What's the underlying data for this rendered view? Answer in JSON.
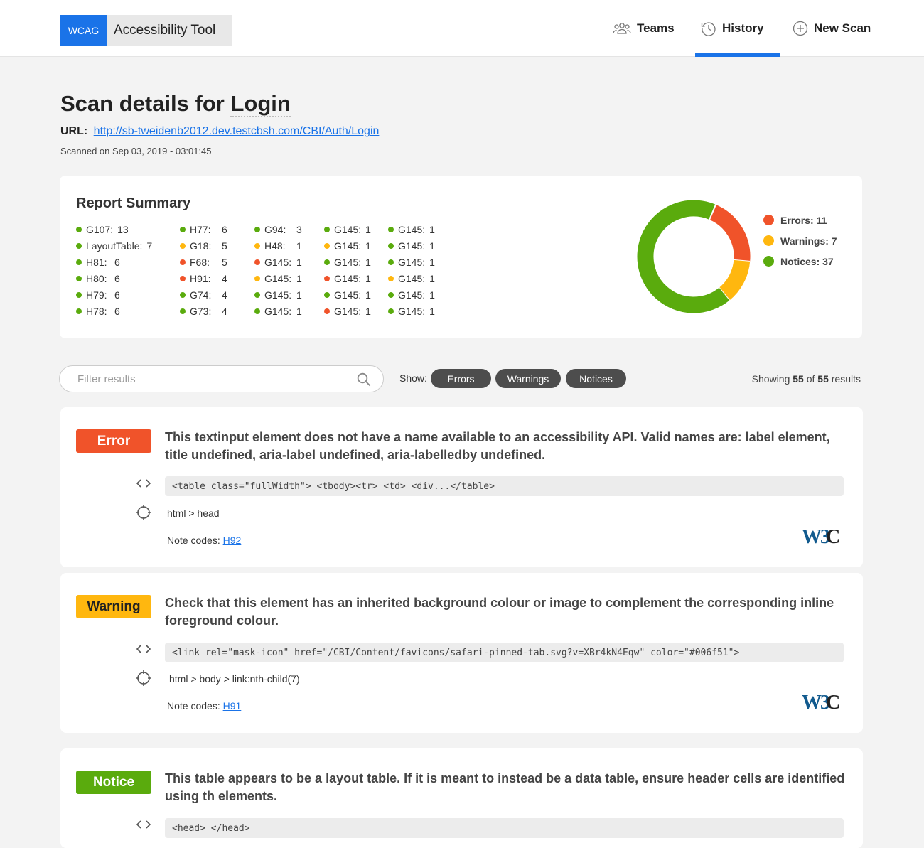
{
  "header": {
    "brand_badge": "WCAG",
    "brand_name": "Accessibility Tool",
    "nav": [
      {
        "label": "Teams",
        "icon": "users-icon"
      },
      {
        "label": "History",
        "icon": "clock-icon",
        "active": true
      },
      {
        "label": "New Scan",
        "icon": "plus-circle-icon"
      }
    ]
  },
  "page": {
    "title_prefix": "Scan details for",
    "title_page": "Login",
    "url_label": "URL:",
    "url": "http://sb-tweidenb2012.dev.testcbsh.com/CBI/Auth/Login",
    "scanned": "Scanned on Sep 03, 2019 - 03:01:45"
  },
  "summary": {
    "title": "Report Summary",
    "colors": {
      "error": "#f0532a",
      "warning": "#ffb70f",
      "notice": "#5aab0d"
    },
    "columns": [
      [
        {
          "code": "G107:",
          "value": "13",
          "type": "notice"
        },
        {
          "code": "LayoutTable:",
          "value": "7",
          "type": "notice"
        },
        {
          "code": "H81:",
          "value": "6",
          "type": "notice"
        },
        {
          "code": "H80:",
          "value": "6",
          "type": "notice"
        },
        {
          "code": "H79:",
          "value": "6",
          "type": "notice"
        },
        {
          "code": "H78:",
          "value": "6",
          "type": "notice"
        }
      ],
      [
        {
          "code": "H77:",
          "value": "6",
          "type": "notice"
        },
        {
          "code": "G18:",
          "value": "5",
          "type": "warning"
        },
        {
          "code": "F68:",
          "value": "5",
          "type": "error"
        },
        {
          "code": "H91:",
          "value": "4",
          "type": "error"
        },
        {
          "code": "G74:",
          "value": "4",
          "type": "notice"
        },
        {
          "code": "G73:",
          "value": "4",
          "type": "notice"
        }
      ],
      [
        {
          "code": "G94:",
          "value": "3",
          "type": "notice"
        },
        {
          "code": "H48:",
          "value": "1",
          "type": "warning"
        },
        {
          "code": "G145:",
          "value": "1",
          "type": "error"
        },
        {
          "code": "G145:",
          "value": "1",
          "type": "warning"
        },
        {
          "code": "G145:",
          "value": "1",
          "type": "notice"
        },
        {
          "code": "G145:",
          "value": "1",
          "type": "notice"
        }
      ],
      [
        {
          "code": "G145:",
          "value": "1",
          "type": "notice"
        },
        {
          "code": "G145:",
          "value": "1",
          "type": "warning"
        },
        {
          "code": "G145:",
          "value": "1",
          "type": "notice"
        },
        {
          "code": "G145:",
          "value": "1",
          "type": "error"
        },
        {
          "code": "G145:",
          "value": "1",
          "type": "notice"
        },
        {
          "code": "G145:",
          "value": "1",
          "type": "error"
        }
      ],
      [
        {
          "code": "G145:",
          "value": "1",
          "type": "notice"
        },
        {
          "code": "G145:",
          "value": "1",
          "type": "notice"
        },
        {
          "code": "G145:",
          "value": "1",
          "type": "notice"
        },
        {
          "code": "G145:",
          "value": "1",
          "type": "warning"
        },
        {
          "code": "G145:",
          "value": "1",
          "type": "notice"
        },
        {
          "code": "G145:",
          "value": "1",
          "type": "notice"
        }
      ]
    ],
    "legend": [
      {
        "label": "Errors: 11",
        "type": "error",
        "value": 11
      },
      {
        "label": "Warnings: 7",
        "type": "warning",
        "value": 7
      },
      {
        "label": "Notices: 37",
        "type": "notice",
        "value": 37
      }
    ]
  },
  "filter": {
    "placeholder": "Filter results",
    "show_label": "Show:",
    "pills": [
      "Errors",
      "Warnings",
      "Notices"
    ],
    "showing_prefix": "Showing",
    "showing_count": "55",
    "showing_of": "of",
    "showing_total": "55",
    "showing_suffix": "results"
  },
  "issues": [
    {
      "type": "Error",
      "color": "#f0532a",
      "message": "This textinput element does not have a name available to an accessibility API. Valid names are: label element, title undefined, aria-label undefined, aria-labelledby undefined.",
      "code": "<table class=\"fullWidth\"> <tbody><tr> <td> <div...</table>",
      "selector": "html > head",
      "notes_label": "Note codes:",
      "note_code": "H92"
    },
    {
      "type": "Warning",
      "color": "#ffb70f",
      "message": "Check that this element has an inherited background colour or image to complement the corresponding inline foreground colour.",
      "code": "<link rel=\"mask-icon\" href=\"/CBI/Content/favicons/safari-pinned-tab.svg?v=XBr4kN4Eqw\" color=\"#006f51\">",
      "selector": "html > body > link:nth-child(7)",
      "notes_label": "Note codes:",
      "note_code": "H91"
    },
    {
      "type": "Notice",
      "color": "#5aab0d",
      "message": "This table appears to be a layout table. If it is meant to instead be a data table, ensure header cells are identified using th elements.",
      "code": "<head> </head>"
    }
  ]
}
